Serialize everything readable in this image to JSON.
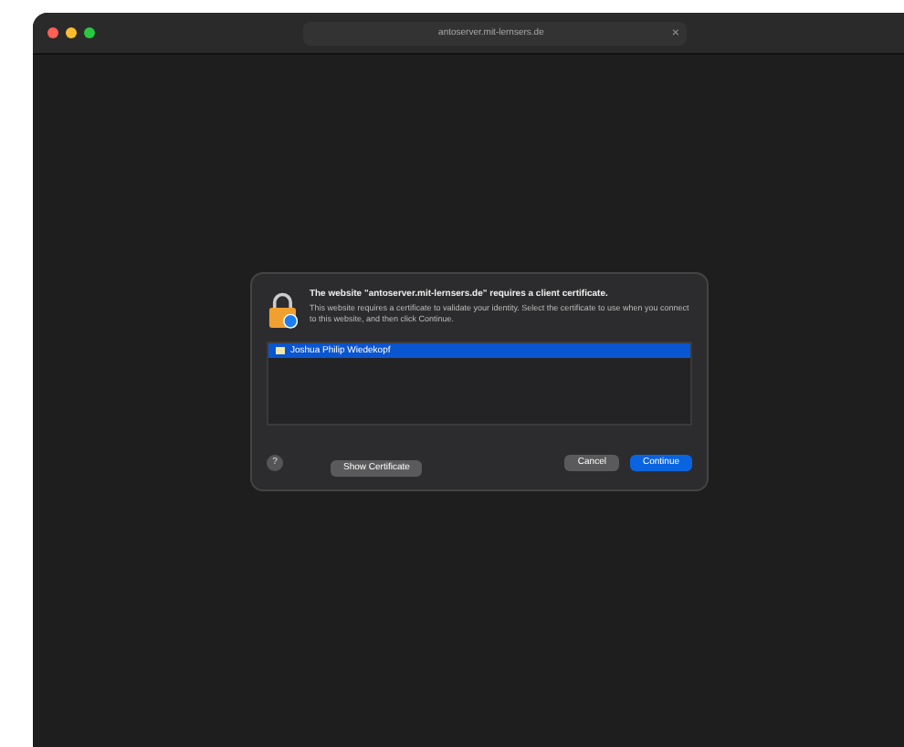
{
  "browser": {
    "address": "antoserver.mit-lernsers.de",
    "close_tab": "×"
  },
  "dialog": {
    "title": "The website \"antoserver.mit-lernsers.de\" requires a client certificate.",
    "message": "This website requires a certificate to validate your identity. Select the certificate to use when you connect to this website, and then click Continue.",
    "certificates": [
      {
        "name": "Joshua Philip Wiedekopf",
        "selected": true
      }
    ],
    "help": "?",
    "buttons": [
      {
        "label": "Show Certificate",
        "kind": "secondary"
      },
      {
        "label": "Cancel",
        "kind": "secondary"
      },
      {
        "label": "Continue",
        "kind": "primary"
      }
    ]
  }
}
